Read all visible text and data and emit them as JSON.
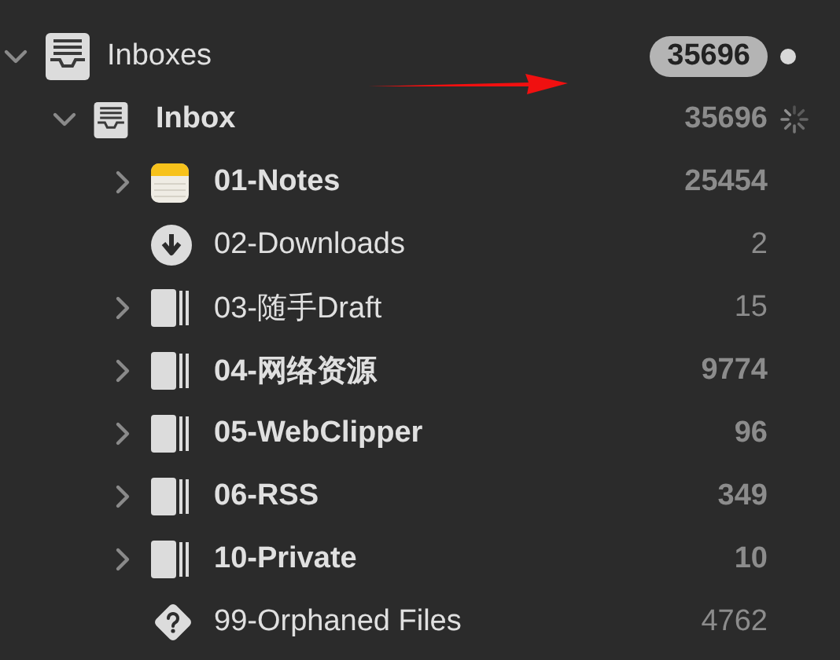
{
  "sidebar": {
    "items": [
      {
        "label": "Inboxes",
        "kind": "tray",
        "bold": false,
        "expanded": true,
        "count": "35696",
        "children": [
          {
            "label": "Inbox",
            "kind": "tray",
            "bold": true,
            "expanded": true,
            "syncing": true,
            "count": "35696",
            "children": [
              {
                "label": "01-Notes",
                "kind": "notes",
                "bold": true,
                "expanded": false,
                "count": "25454"
              },
              {
                "label": "02-Downloads",
                "kind": "download",
                "bold": false,
                "count": "2"
              },
              {
                "label": "03-随手Draft",
                "kind": "book",
                "bold": false,
                "expanded": false,
                "count": "15"
              },
              {
                "label": "04-网络资源",
                "kind": "book",
                "bold": true,
                "expanded": false,
                "count": "9774"
              },
              {
                "label": "05-WebClipper",
                "kind": "book",
                "bold": true,
                "expanded": false,
                "count": "96"
              },
              {
                "label": "06-RSS",
                "kind": "book",
                "bold": true,
                "expanded": false,
                "count": "349"
              },
              {
                "label": "10-Private",
                "kind": "book",
                "bold": true,
                "expanded": false,
                "count": "10"
              },
              {
                "label": "99-Orphaned Files",
                "kind": "unknown",
                "bold": false,
                "count": "4762"
              }
            ]
          }
        ]
      }
    ]
  },
  "annotations": [
    {
      "kind": "arrow"
    }
  ]
}
